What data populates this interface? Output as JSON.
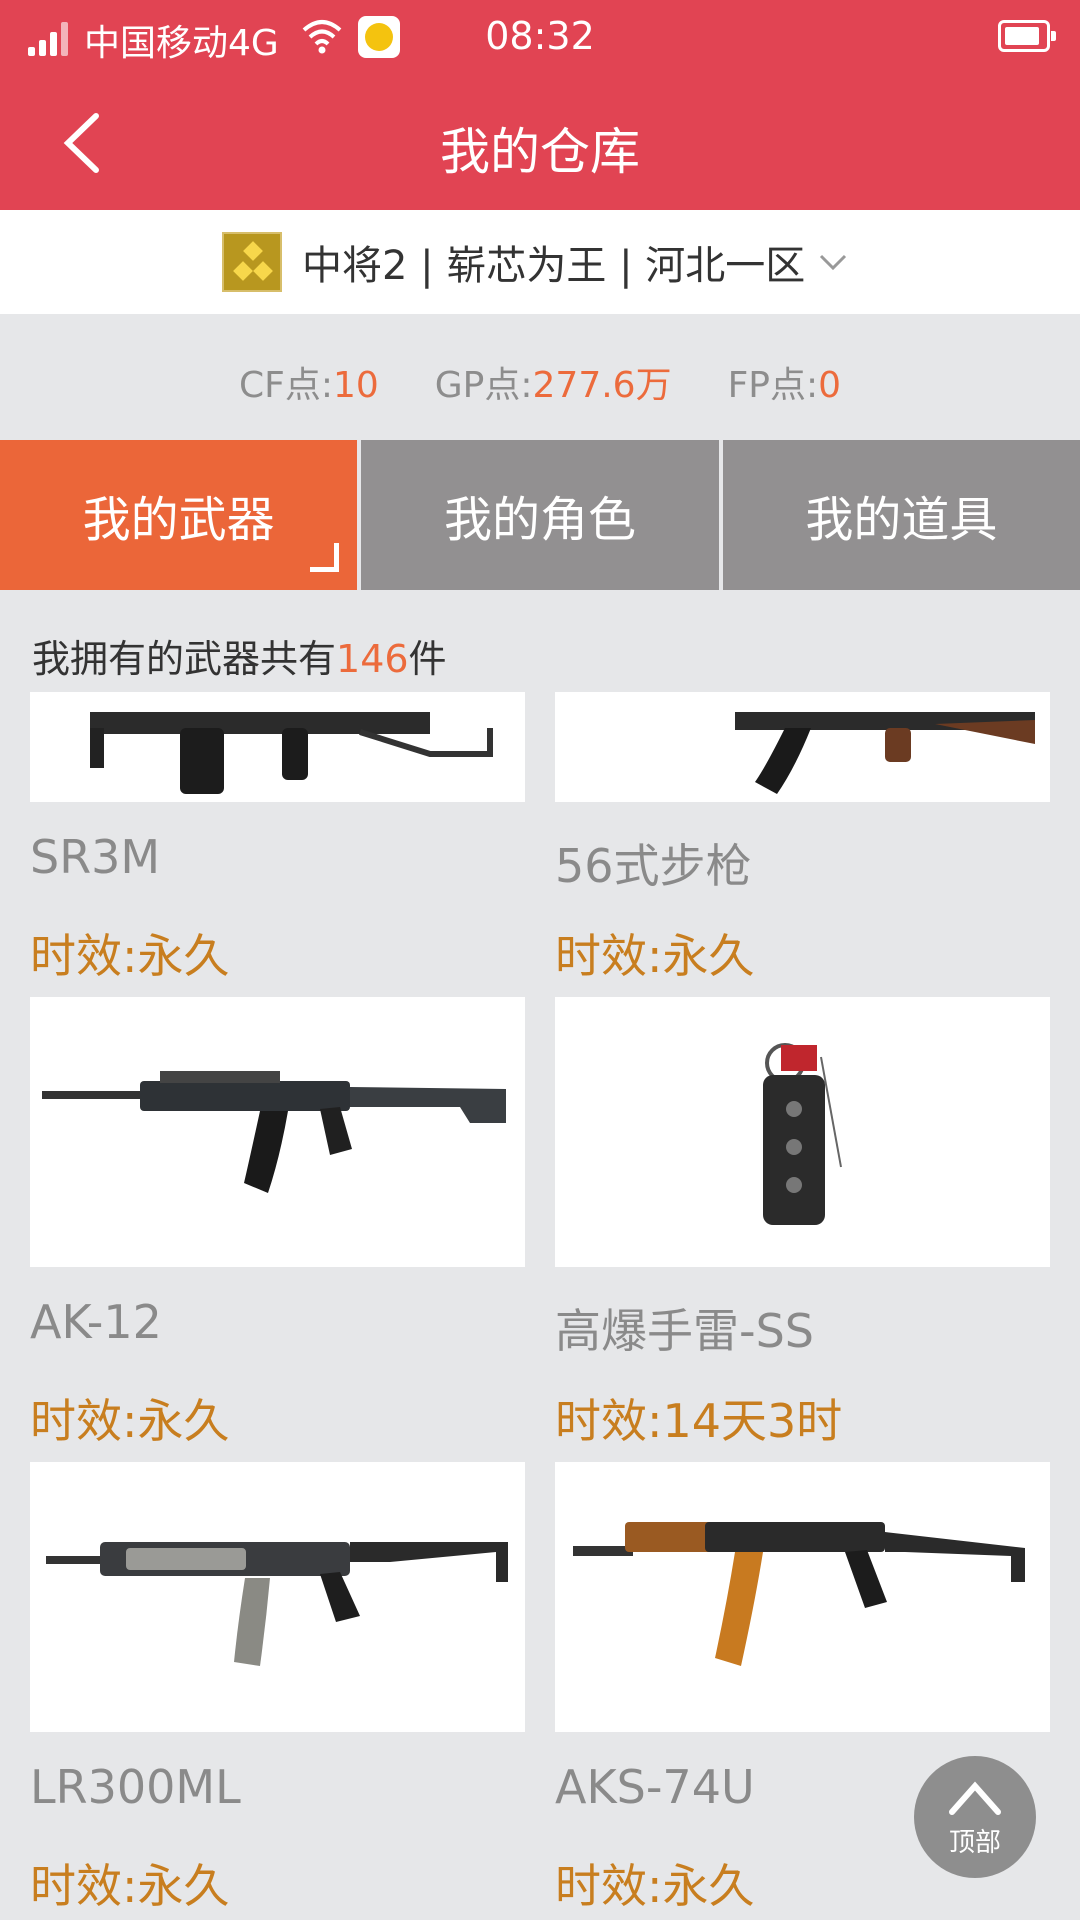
{
  "status_bar": {
    "carrier": "中国移动4G",
    "time": "08:32",
    "icons": [
      "signal-icon",
      "wifi-icon",
      "qq-app-icon",
      "battery-icon"
    ]
  },
  "header": {
    "title": "我的仓库",
    "back_icon": "chevron-left-icon"
  },
  "account": {
    "rank_icon": "rank-badge-icon",
    "label": "中将2 | 崭芯为王 | 河北一区",
    "dropdown_icon": "chevron-down-icon"
  },
  "points": [
    {
      "label": "CF点:",
      "value": "10"
    },
    {
      "label": "GP点:",
      "value": "277.6万"
    },
    {
      "label": "FP点:",
      "value": "0"
    }
  ],
  "tabs": [
    {
      "label": "我的武器",
      "active": true
    },
    {
      "label": "我的角色",
      "active": false
    },
    {
      "label": "我的道具",
      "active": false
    }
  ],
  "count": {
    "prefix": "我拥有的武器共有",
    "number": "146",
    "suffix": "件"
  },
  "items": [
    {
      "name": "SR3M",
      "duration": "时效:永久",
      "icon": "rifle-image"
    },
    {
      "name": "56式步枪",
      "duration": "时效:永久",
      "icon": "rifle-image"
    },
    {
      "name": "AK-12",
      "duration": "时效:永久",
      "icon": "rifle-image"
    },
    {
      "name": "高爆手雷-SS",
      "duration": "时效:14天3时",
      "icon": "grenade-image"
    },
    {
      "name": "LR300ML",
      "duration": "时效:永久",
      "icon": "rifle-image"
    },
    {
      "name": "AKS-74U",
      "duration": "时效:永久",
      "icon": "rifle-image"
    }
  ],
  "back_to_top": {
    "label": "顶部",
    "icon": "arrow-up-icon"
  },
  "colors": {
    "header": "#e14453",
    "accent": "#eb6639",
    "tab_inactive": "#929091",
    "duration": "#c87e1f"
  }
}
